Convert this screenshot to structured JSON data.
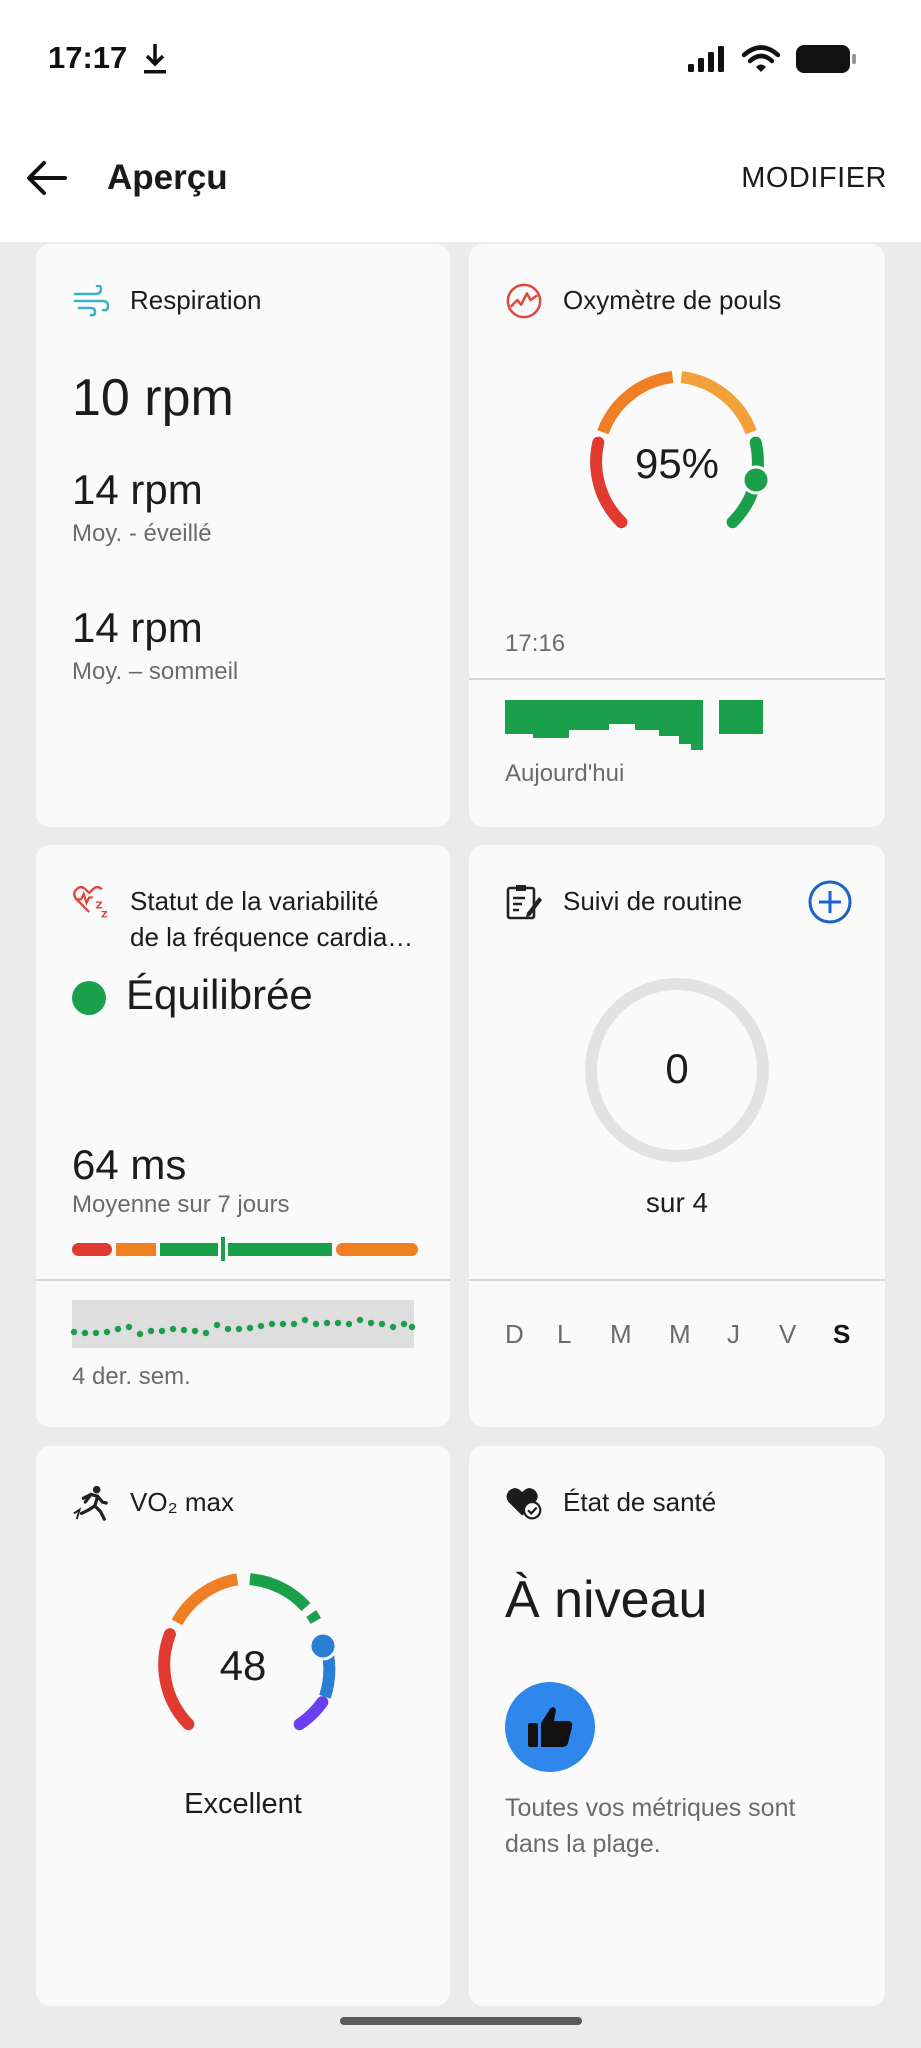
{
  "status": {
    "time": "17:17"
  },
  "appbar": {
    "title": "Aperçu",
    "edit_label": "MODIFIER"
  },
  "respiration": {
    "title": "Respiration",
    "current": "10 rpm",
    "awake_value": "14 rpm",
    "awake_label": "Moy. - éveillé",
    "sleep_value": "14 rpm",
    "sleep_label": "Moy. – sommeil"
  },
  "oximeter": {
    "title": "Oxymètre de pouls",
    "value": "95%",
    "time": "17:16",
    "day_label": "Aujourd'hui"
  },
  "hrv": {
    "title_line1": "Statut de la variabilité",
    "title_line2": "de la fréquence cardia…",
    "status": "Équilibrée",
    "value": "64 ms",
    "value_label": "Moyenne sur 7 jours",
    "range_label": "4 der. sem.",
    "status_color": "#1aa04a"
  },
  "routine": {
    "title": "Suivi de routine",
    "count": "0",
    "total": "sur 4",
    "days": [
      "D",
      "L",
      "M",
      "M",
      "J",
      "V",
      "S"
    ]
  },
  "vo2": {
    "title": "VO₂ max",
    "value": "48",
    "label": "Excellent"
  },
  "health": {
    "title": "État de santé",
    "status": "À niveau",
    "desc_line1": "Toutes vos métriques sont",
    "desc_line2": "dans la plage.",
    "accent": "#2f86eb"
  }
}
